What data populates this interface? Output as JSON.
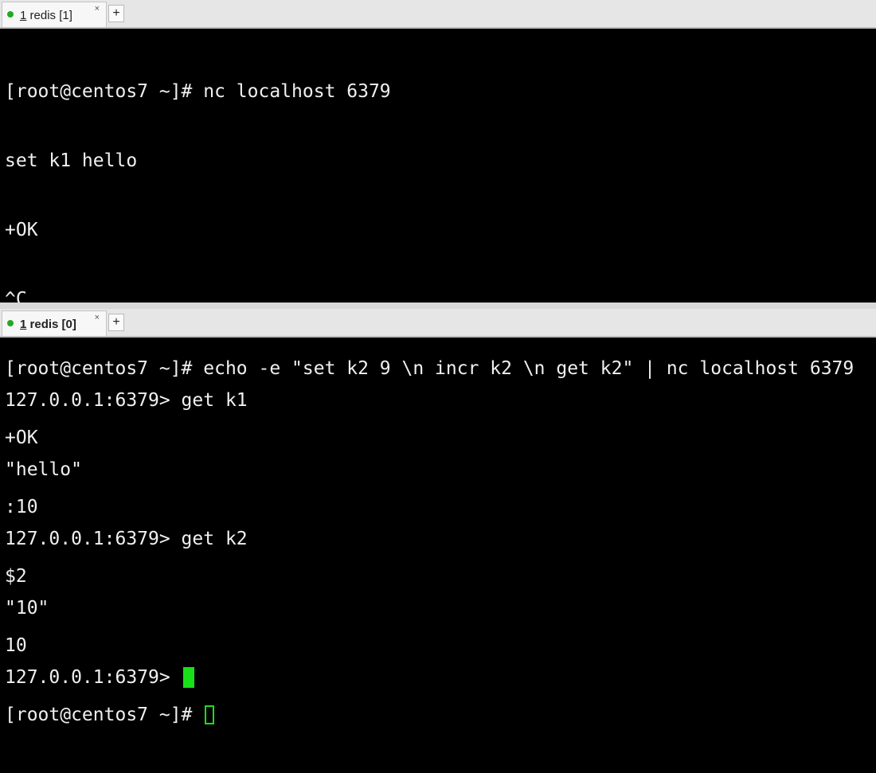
{
  "top_pane": {
    "tab": {
      "number": "1",
      "label_rest": " redis [1]",
      "close_symbol": "×"
    },
    "new_tab_symbol": "+",
    "lines": [
      "[root@centos7 ~]# nc localhost 6379",
      "set k1 hello",
      "+OK",
      "^C",
      "[root@centos7 ~]# echo -e \"set k2 9 \\n incr k2 \\n get k2\" | nc localhost 6379",
      "+OK",
      ":10",
      "$2",
      "10"
    ],
    "prompt": "[root@centos7 ~]# "
  },
  "bottom_pane": {
    "tab": {
      "number": "1",
      "label_rest": " redis [0]",
      "close_symbol": "×"
    },
    "new_tab_symbol": "+",
    "lines": [
      "127.0.0.1:6379> get k1",
      "\"hello\"",
      "127.0.0.1:6379> get k2",
      "\"10\""
    ],
    "prompt": "127.0.0.1:6379> "
  },
  "colors": {
    "cursor": "#18e018",
    "status_dot": "#22aa22",
    "terminal_bg": "#000000",
    "terminal_fg": "#f0f0f0"
  },
  "icons": {
    "status": "status-dot-icon",
    "close": "close-icon",
    "add": "plus-icon"
  }
}
